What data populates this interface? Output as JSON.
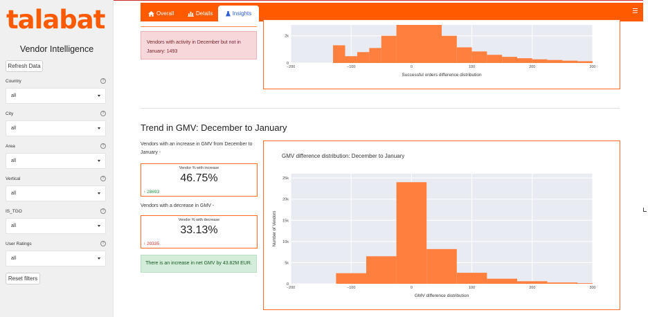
{
  "sidebar": {
    "logo": "talabat",
    "app_title": "Vendor Intelligence",
    "refresh_label": "Refresh Data",
    "reset_label": "Reset filters",
    "help_glyph": "?",
    "filters": [
      {
        "label": "Country",
        "value": "all"
      },
      {
        "label": "City",
        "value": "all"
      },
      {
        "label": "Area",
        "value": "all"
      },
      {
        "label": "Vertical",
        "value": "all"
      },
      {
        "label": "IS_TGO",
        "value": "all"
      },
      {
        "label": "User Ratings",
        "value": "all"
      }
    ]
  },
  "navbar": {
    "tabs": [
      {
        "label": "Overall",
        "icon": "home-icon"
      },
      {
        "label": "Details",
        "icon": "bar-chart-icon"
      },
      {
        "label": "Insights",
        "icon": "flask-icon",
        "active": true
      }
    ],
    "menu_icon": "hamburger-icon",
    "color": "#ff5a00"
  },
  "orders_section": {
    "alert_text": "Vendors with activity in December but not in January: 1493"
  },
  "gmv_section": {
    "title": "Trend in GMV: December to January",
    "increase_text": "Vendors with an increase in GMV from December to January -",
    "increase_kpi": {
      "label": "Vendor % with increase",
      "value": "46.75%",
      "delta": "28693",
      "delta_arrow": "↑",
      "delta_color": "#1e8e3e"
    },
    "decrease_text": "Vendors with a decrease in GMV -",
    "decrease_kpi": {
      "label": "Vendor % with decrease",
      "value": "33.13%",
      "delta": "20335",
      "delta_arrow": "↑",
      "delta_color": "#d93025"
    },
    "net_alert": "There is an increase in net GMV by 43.82M EUR."
  },
  "chart_data": [
    {
      "type": "bar",
      "title": "",
      "xlabel": "Successful orders difference distribution",
      "ylabel": "",
      "xlim": [
        -200,
        300
      ],
      "ylim": [
        0,
        2800
      ],
      "xticks": [
        -200,
        -100,
        0,
        100,
        200,
        300
      ],
      "xtick_labels": [
        "−200",
        "−100",
        "0",
        "100",
        "200",
        "300"
      ],
      "yticks": [
        0,
        2000
      ],
      "ytick_labels": [
        "0",
        "2k"
      ],
      "bins": [
        {
          "x0": -130,
          "x1": -110,
          "y": 1300
        },
        {
          "x0": -110,
          "x1": -90,
          "y": 500
        },
        {
          "x0": -90,
          "x1": -70,
          "y": 800
        },
        {
          "x0": -70,
          "x1": -50,
          "y": 1100
        },
        {
          "x0": -50,
          "x1": -25,
          "y": 2000
        },
        {
          "x0": -25,
          "x1": 50,
          "y": 2800
        },
        {
          "x0": 50,
          "x1": 75,
          "y": 2000
        },
        {
          "x0": 75,
          "x1": 100,
          "y": 1150
        },
        {
          "x0": 100,
          "x1": 125,
          "y": 850
        },
        {
          "x0": 125,
          "x1": 150,
          "y": 600
        },
        {
          "x0": 150,
          "x1": 175,
          "y": 450
        },
        {
          "x0": 175,
          "x1": 200,
          "y": 350
        },
        {
          "x0": 200,
          "x1": 225,
          "y": 270
        },
        {
          "x0": 225,
          "x1": 250,
          "y": 220
        },
        {
          "x0": 250,
          "x1": 275,
          "y": 170
        },
        {
          "x0": 275,
          "x1": 300,
          "y": 130
        }
      ],
      "color": "#ff7f3f"
    },
    {
      "type": "bar",
      "title": "GMV difference distribution: December to January",
      "xlabel": "GMV difference distribution",
      "ylabel": "Number of Vendors",
      "xlim": [
        -200,
        300
      ],
      "ylim": [
        0,
        26000
      ],
      "xticks": [
        -200,
        -100,
        0,
        100,
        200,
        300
      ],
      "xtick_labels": [
        "−200",
        "−100",
        "0",
        "100",
        "200",
        "300"
      ],
      "yticks": [
        0,
        5000,
        10000,
        15000,
        20000,
        25000
      ],
      "ytick_labels": [
        "0",
        "5k",
        "10k",
        "15k",
        "20k",
        "25k"
      ],
      "bins": [
        {
          "x0": -125,
          "x1": -75,
          "y": 2500
        },
        {
          "x0": -75,
          "x1": -25,
          "y": 6500
        },
        {
          "x0": -25,
          "x1": 25,
          "y": 24000
        },
        {
          "x0": 25,
          "x1": 75,
          "y": 8200
        },
        {
          "x0": 75,
          "x1": 125,
          "y": 2600
        },
        {
          "x0": 125,
          "x1": 175,
          "y": 1200
        },
        {
          "x0": 175,
          "x1": 225,
          "y": 600
        },
        {
          "x0": 225,
          "x1": 275,
          "y": 300
        },
        {
          "x0": 275,
          "x1": 300,
          "y": 150
        }
      ],
      "color": "#ff7f3f"
    }
  ]
}
